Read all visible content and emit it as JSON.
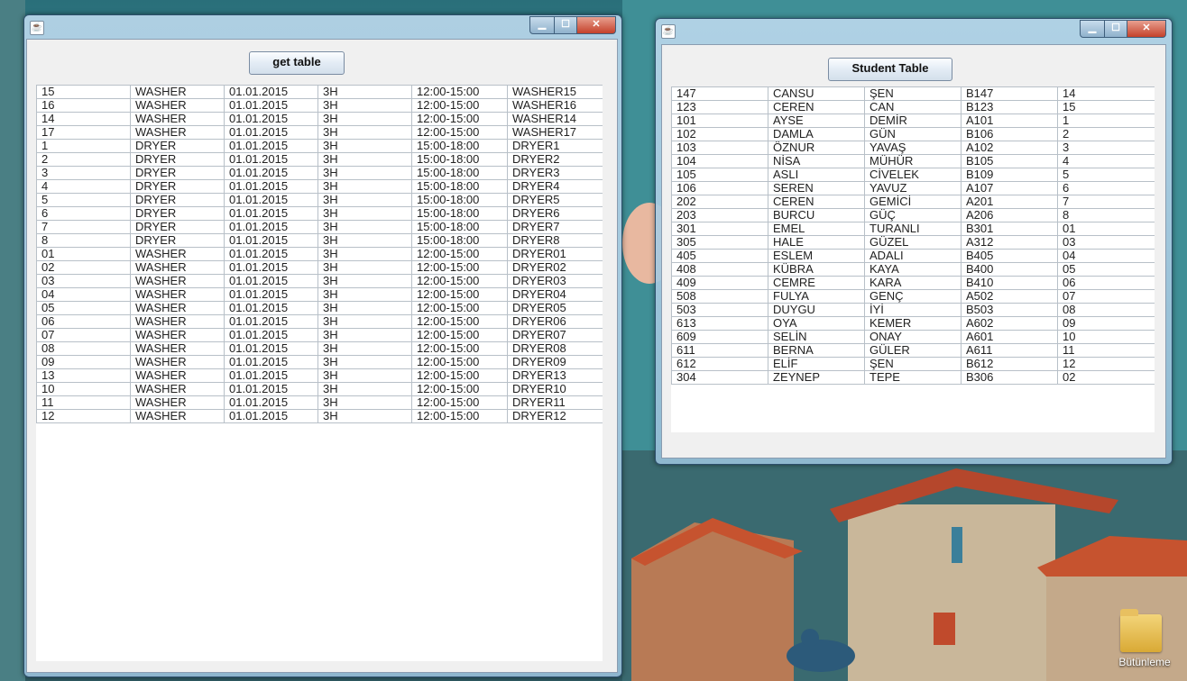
{
  "left_window": {
    "get_table_label": "get table",
    "rows": [
      [
        "15",
        "WASHER",
        "01.01.2015",
        "3H",
        "12:00-15:00",
        "WASHER15"
      ],
      [
        "16",
        "WASHER",
        "01.01.2015",
        "3H",
        "12:00-15:00",
        "WASHER16"
      ],
      [
        "14",
        "WASHER",
        "01.01.2015",
        "3H",
        "12:00-15:00",
        "WASHER14"
      ],
      [
        "17",
        "WASHER",
        "01.01.2015",
        "3H",
        "12:00-15:00",
        "WASHER17"
      ],
      [
        "1",
        "DRYER",
        "01.01.2015",
        "3H",
        "15:00-18:00",
        "DRYER1"
      ],
      [
        "2",
        "DRYER",
        "01.01.2015",
        "3H",
        "15:00-18:00",
        "DRYER2"
      ],
      [
        "3",
        "DRYER",
        "01.01.2015",
        "3H",
        "15:00-18:00",
        "DRYER3"
      ],
      [
        "4",
        "DRYER",
        "01.01.2015",
        "3H",
        "15:00-18:00",
        "DRYER4"
      ],
      [
        "5",
        "DRYER",
        "01.01.2015",
        "3H",
        "15:00-18:00",
        "DRYER5"
      ],
      [
        "6",
        "DRYER",
        "01.01.2015",
        "3H",
        "15:00-18:00",
        "DRYER6"
      ],
      [
        "7",
        "DRYER",
        "01.01.2015",
        "3H",
        "15:00-18:00",
        "DRYER7"
      ],
      [
        "8",
        "DRYER",
        "01.01.2015",
        "3H",
        "15:00-18:00",
        "DRYER8"
      ],
      [
        "01",
        "WASHER",
        "01.01.2015",
        "3H",
        "12:00-15:00",
        "DRYER01"
      ],
      [
        "02",
        "WASHER",
        "01.01.2015",
        "3H",
        "12:00-15:00",
        "DRYER02"
      ],
      [
        "03",
        "WASHER",
        "01.01.2015",
        "3H",
        "12:00-15:00",
        "DRYER03"
      ],
      [
        "04",
        "WASHER",
        "01.01.2015",
        "3H",
        "12:00-15:00",
        "DRYER04"
      ],
      [
        "05",
        "WASHER",
        "01.01.2015",
        "3H",
        "12:00-15:00",
        "DRYER05"
      ],
      [
        "06",
        "WASHER",
        "01.01.2015",
        "3H",
        "12:00-15:00",
        "DRYER06"
      ],
      [
        "07",
        "WASHER",
        "01.01.2015",
        "3H",
        "12:00-15:00",
        "DRYER07"
      ],
      [
        "08",
        "WASHER",
        "01.01.2015",
        "3H",
        "12:00-15:00",
        "DRYER08"
      ],
      [
        "09",
        "WASHER",
        "01.01.2015",
        "3H",
        "12:00-15:00",
        "DRYER09"
      ],
      [
        "13",
        "WASHER",
        "01.01.2015",
        "3H",
        "12:00-15:00",
        "DRYER13"
      ],
      [
        "10",
        "WASHER",
        "01.01.2015",
        "3H",
        "12:00-15:00",
        "DRYER10"
      ],
      [
        "11",
        "WASHER",
        "01.01.2015",
        "3H",
        "12:00-15:00",
        "DRYER11"
      ],
      [
        "12",
        "WASHER",
        "01.01.2015",
        "3H",
        "12:00-15:00",
        "DRYER12"
      ]
    ]
  },
  "right_window": {
    "student_table_label": "Student Table",
    "rows": [
      [
        "147",
        "CANSU",
        "ŞEN",
        "B147",
        "14"
      ],
      [
        "123",
        "CEREN",
        "CAN",
        "B123",
        "15"
      ],
      [
        "101",
        "AYSE",
        "DEMİR",
        "A101",
        "1"
      ],
      [
        "102",
        "DAMLA",
        "GÜN",
        "B106",
        "2"
      ],
      [
        "103",
        "ÖZNUR",
        "YAVAŞ",
        "A102",
        "3"
      ],
      [
        "104",
        "NİSA",
        "MÜHÜR",
        "B105",
        "4"
      ],
      [
        "105",
        "ASLI",
        "CİVELEK",
        "B109",
        "5"
      ],
      [
        "106",
        "SEREN",
        "YAVUZ",
        "A107",
        "6"
      ],
      [
        "202",
        "CEREN",
        "GEMİCİ",
        "A201",
        "7"
      ],
      [
        "203",
        "BURCU",
        "GÜÇ",
        "A206",
        "8"
      ],
      [
        "301",
        "EMEL",
        "TURANLI",
        "B301",
        "01"
      ],
      [
        "305",
        "HALE",
        "GÜZEL",
        "A312",
        "03"
      ],
      [
        "405",
        "ESLEM",
        "ADALI",
        "B405",
        "04"
      ],
      [
        "408",
        "KÜBRA",
        "KAYA",
        "B400",
        "05"
      ],
      [
        "409",
        "CEMRE",
        "KARA",
        "B410",
        "06"
      ],
      [
        "508",
        "FULYA",
        "GENÇ",
        "A502",
        "07"
      ],
      [
        "503",
        "DUYGU",
        "İYİ",
        "B503",
        "08"
      ],
      [
        "613",
        "OYA",
        "KEMER",
        "A602",
        "09"
      ],
      [
        "609",
        "SELİN",
        "ONAY",
        "A601",
        "10"
      ],
      [
        "611",
        "BERNA",
        "GÜLER",
        "A611",
        "11"
      ],
      [
        "612",
        "ELİF",
        "ŞEN",
        "B612",
        "12"
      ],
      [
        "304",
        "ZEYNEP",
        "TEPE",
        "B306",
        "02"
      ]
    ]
  },
  "desktop": {
    "folder_label": "Bütünleme"
  },
  "icons": {
    "app": "java-app-icon",
    "minimize": "minimize-icon",
    "maximize": "maximize-icon",
    "close": "close-icon",
    "folder": "folder-icon"
  }
}
